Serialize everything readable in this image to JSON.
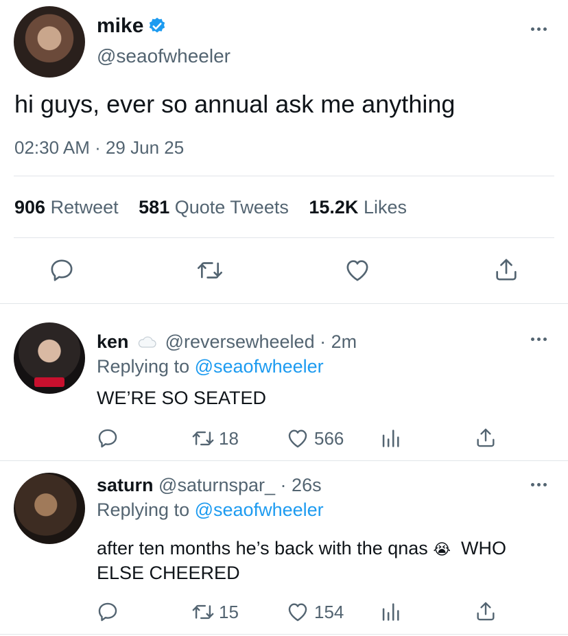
{
  "tweet": {
    "author_name": "mike",
    "author_handle": "@seaofwheeler",
    "text": "hi guys, ever so annual ask me anything",
    "time": "02:30 AM",
    "date": "29 Jun 25",
    "stats": {
      "retweet_count": "906",
      "retweet_label": "Retweet",
      "quote_count": "581",
      "quote_label": "Quote Tweets",
      "likes_count": "15.2K",
      "likes_label": "Likes"
    }
  },
  "replies": [
    {
      "name": "ken",
      "handle": "@reversewheeled",
      "time": "2m",
      "replying_prefix": "Replying to",
      "replying_handle": "@seaofwheeler",
      "text": "WE’RE SO SEATED",
      "retweets": "18",
      "likes": "566"
    },
    {
      "name": "saturn",
      "handle": "@saturnspar_",
      "time": "26s",
      "replying_prefix": "Replying to",
      "replying_handle": "@seaofwheeler",
      "text_part1": "after ten months he’s back with the qnas",
      "emoji": "😭",
      "text_part2": "WHO",
      "text_line2": "ELSE CHEERED",
      "retweets": "15",
      "likes": "154"
    }
  ],
  "colors": {
    "accent": "#1d9bf0",
    "text": "#0f1419",
    "muted": "#536471",
    "divider": "#e1e5e9"
  },
  "icons": [
    "reply-icon",
    "retweet-icon",
    "like-icon",
    "share-icon",
    "analytics-icon",
    "verified-icon",
    "cloud-icon",
    "more-icon"
  ]
}
